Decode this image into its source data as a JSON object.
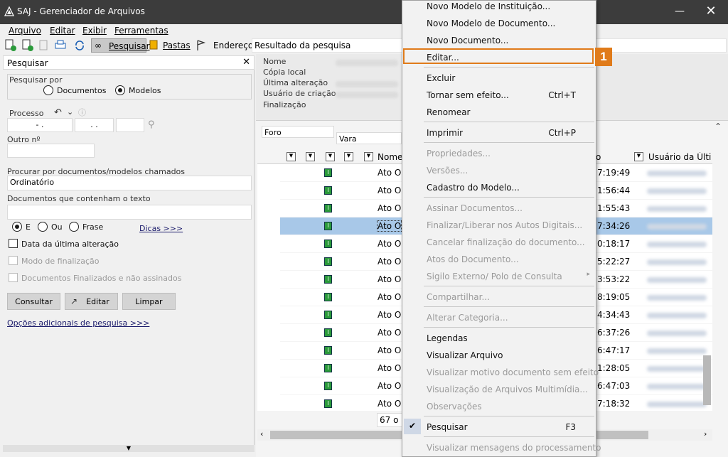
{
  "window": {
    "title": "SAJ - Gerenciador de Arquivos"
  },
  "menubar": [
    "Arquivo",
    "Editar",
    "Exibir",
    "Ferramentas"
  ],
  "toolbar": {
    "search": "Pesquisar",
    "folders": "Pastas",
    "address_label": "Endereço",
    "address_value": "Resultado da pesquisa"
  },
  "left": {
    "header": "Pesquisar",
    "search_by": "Pesquisar por",
    "opt_docs": "Documentos",
    "opt_models": "Modelos",
    "process_label": "Processo",
    "proc1": "-  .",
    "proc2": ".  .",
    "other_label": "Outro nº",
    "names_label": "Procurar por documentos/modelos chamados",
    "names_value": "Ordinatório",
    "text_label": "Documentos que contenham o texto",
    "opt_e": "E",
    "opt_ou": "Ou",
    "opt_frase": "Frase",
    "tips": "Dicas >>>",
    "chk_date": "Data da última alteração",
    "chk_mode": "Modo de finalização",
    "chk_finished": "Documentos Finalizados e não assinados",
    "btn_consult": "Consultar",
    "btn_edit": "Editar",
    "btn_clear": "Limpar",
    "more": "Opções adicionais de pesquisa >>>"
  },
  "props": {
    "name": "Nome",
    "local": "Cópia local",
    "last": "Última alteração",
    "creator": "Usuário de criação",
    "final": "Finalização"
  },
  "grid": {
    "foro": "Foro",
    "vara": "Vara",
    "col_name": "Nome",
    "col_user": "Usuário da Última",
    "col_time_head": "o",
    "row_prefix": "Ato O",
    "count": "67 o",
    "times": [
      "7:19:49",
      "1:56:44",
      "1:55:43",
      "7:34:26",
      "0:18:17",
      "5:22:27",
      "3:53:22",
      "8:19:05",
      "4:34:43",
      "6:37:26",
      "6:47:17",
      "1:28:05",
      "6:47:03",
      "7:18:32"
    ]
  },
  "context_menu": {
    "items": [
      {
        "label": "Novo Modelo de Instituição...",
        "enabled": true
      },
      {
        "label": "Novo Modelo de Documento...",
        "enabled": true
      },
      {
        "label": "Novo Documento...",
        "enabled": true
      },
      {
        "label": "Editar...",
        "enabled": true
      },
      {
        "label": "Excluir",
        "enabled": true
      },
      {
        "label": "Tornar sem efeito...",
        "enabled": true,
        "shortcut": "Ctrl+T"
      },
      {
        "label": "Renomear",
        "enabled": true
      },
      {
        "label": "Imprimir",
        "enabled": true,
        "shortcut": "Ctrl+P"
      },
      {
        "label": "Propriedades...",
        "enabled": false
      },
      {
        "label": "Versões...",
        "enabled": false
      },
      {
        "label": "Cadastro do Modelo...",
        "enabled": true
      },
      {
        "label": "Assinar Documentos...",
        "enabled": false
      },
      {
        "label": "Finalizar/Liberar nos Autos Digitais...",
        "enabled": false
      },
      {
        "label": "Cancelar finalização do documento...",
        "enabled": false
      },
      {
        "label": "Atos do Documento...",
        "enabled": false
      },
      {
        "label": "Sigilo Externo/ Polo de Consulta",
        "enabled": false
      },
      {
        "label": "Compartilhar...",
        "enabled": false
      },
      {
        "label": "Alterar Categoria...",
        "enabled": false
      },
      {
        "label": "Legendas",
        "enabled": true
      },
      {
        "label": "Visualizar Arquivo",
        "enabled": true
      },
      {
        "label": "Visualizar motivo documento sem efeito",
        "enabled": false
      },
      {
        "label": "Visualização de Arquivos Multimídia...",
        "enabled": false
      },
      {
        "label": "Observações",
        "enabled": false
      },
      {
        "label": "Pesquisar",
        "enabled": true,
        "shortcut": "F3",
        "checked": true
      },
      {
        "label": "Visualizar mensagens do processamento",
        "enabled": false
      }
    ],
    "badge": "1"
  },
  "colors": {
    "accent": "#e07b1a",
    "selection": "#a8c8e8",
    "titlebar": "#3c3c3c"
  }
}
